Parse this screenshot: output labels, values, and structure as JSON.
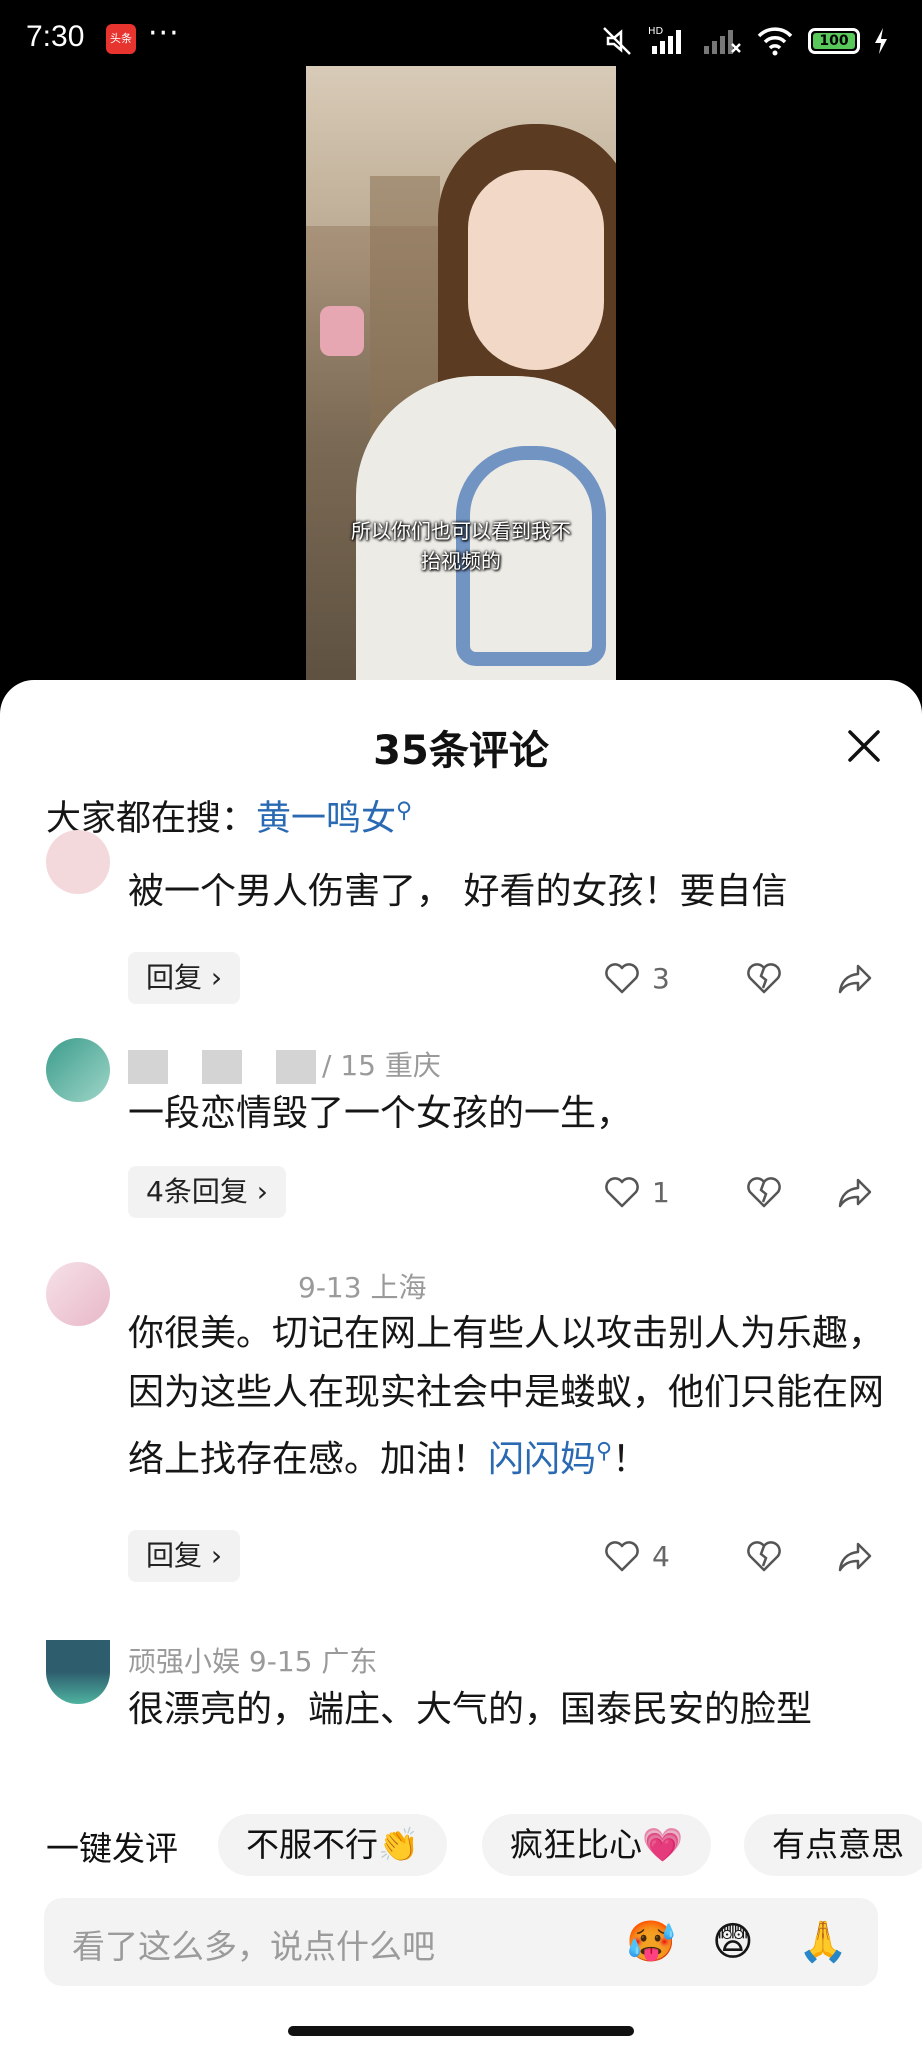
{
  "status_bar": {
    "time": "7:30",
    "app_badge": "头条",
    "more": "···",
    "battery": "100",
    "icons": [
      "mute-icon",
      "hd-signal-icon",
      "signal-icon",
      "wifi-icon",
      "battery-icon",
      "charging-icon"
    ]
  },
  "video": {
    "subtitle_line1": "所以你们也可以看到我不",
    "subtitle_line2": "抬视频的"
  },
  "sheet": {
    "title": "35条评论",
    "search_hint_label": "大家都在搜：",
    "search_hint_keyword": "黄一鸣女"
  },
  "comments": [
    {
      "text": "被一个男人伤害了， 好看的女孩！要自信",
      "reply_label": "回复 ›",
      "likes": "3"
    },
    {
      "meta_visible": "/ 15  重庆",
      "text": "一段恋情毁了一个女孩的一生，",
      "reply_label": "4条回复 ›",
      "likes": "1"
    },
    {
      "meta_visible": "9-13  上海",
      "text_plain": "你很美。切记在网上有些人以攻击别人为乐趣，因为这些人在现实社会中是蝼蚁，他们只能在网络上找存在感。加油！",
      "text_keyword": "闪闪妈",
      "text_tail": "！",
      "reply_label": "回复 ›",
      "likes": "4"
    },
    {
      "meta_visible": "顽强小娱  9-15  广东",
      "text": "很漂亮的，端庄、大气的，国泰民安的脸型"
    }
  ],
  "quick_reactions": {
    "label": "一键发评",
    "chips": [
      "不服不行👏",
      "疯狂比心💗",
      "有点意思"
    ]
  },
  "input": {
    "placeholder": "看了这么多，说点什么吧",
    "emojis": [
      "🥵",
      "😨",
      "🙏"
    ]
  },
  "colors": {
    "link": "#2a6ab3",
    "muted": "#9a9a9a",
    "chip_bg": "#f3f3f3"
  }
}
